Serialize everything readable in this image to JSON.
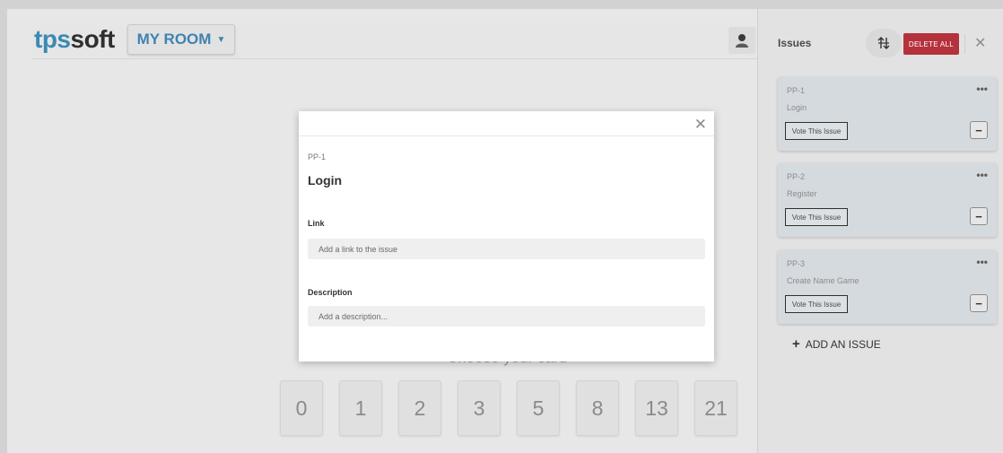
{
  "header": {
    "logo_part1": "tps",
    "logo_part2": "soft",
    "room_label": "MY ROOM"
  },
  "board": {
    "choose_label": "Choose your card",
    "cards": [
      "0",
      "1",
      "2",
      "3",
      "5",
      "8",
      "13",
      "21"
    ]
  },
  "panel": {
    "title": "Issues",
    "delete_all_label": "DELETE ALL",
    "close_glyph": "✕",
    "issues": [
      {
        "key": "PP-1",
        "title": "Login",
        "vote_label": "Vote This Issue"
      },
      {
        "key": "PP-2",
        "title": "Register",
        "vote_label": "Vote This Issue"
      },
      {
        "key": "PP-3",
        "title": "Create Name Game",
        "vote_label": "Vote This Issue"
      }
    ],
    "add_issue_label": "ADD AN ISSUE"
  },
  "modal": {
    "close_glyph": "✕",
    "key": "PP-1",
    "title": "Login",
    "link_label": "Link",
    "link_placeholder": "Add a link to the issue",
    "description_label": "Description",
    "description_placeholder": "Add a description..."
  },
  "colors": {
    "brand_blue": "#3a8ab3",
    "delete_red": "#b4323c"
  },
  "icons": {
    "room_dropdown": "chevron-down-icon",
    "avatar": "user-avatar-icon",
    "sort": "sort-arrows-icon",
    "issue_menu": "more-dots-icon"
  }
}
